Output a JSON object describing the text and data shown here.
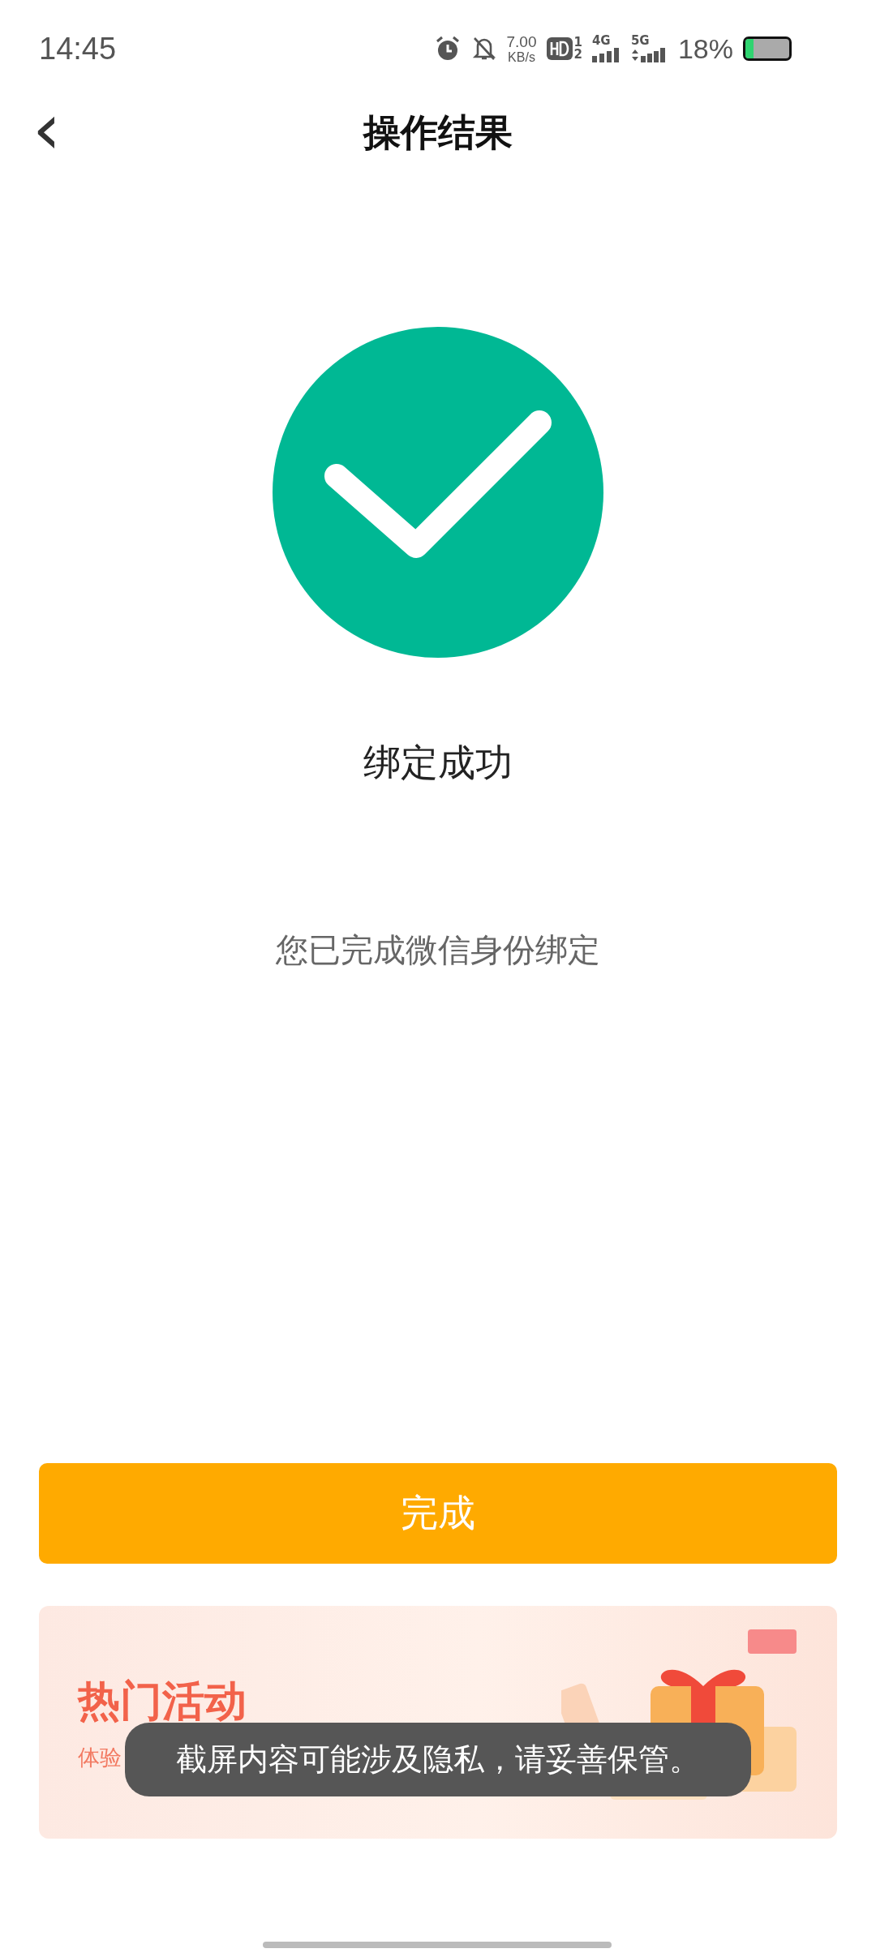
{
  "status_bar": {
    "time": "14:45",
    "speed_value": "7.00",
    "speed_unit": "KB/s",
    "hd_sup": "1",
    "hd_sub": "2",
    "net_4g": "4G",
    "net_5g": "5G",
    "battery_text": "18%",
    "battery": {
      "level": 0.18
    }
  },
  "nav": {
    "back": "‹",
    "title": "操作结果"
  },
  "result": {
    "title": "绑定成功",
    "message": "您已完成微信身份绑定"
  },
  "done_button": {
    "label": "完成"
  },
  "promo": {
    "title": "热门活动",
    "subtitle": "体验"
  },
  "toast": {
    "text": "截屏内容可能涉及隐私，请妥善保管。"
  }
}
